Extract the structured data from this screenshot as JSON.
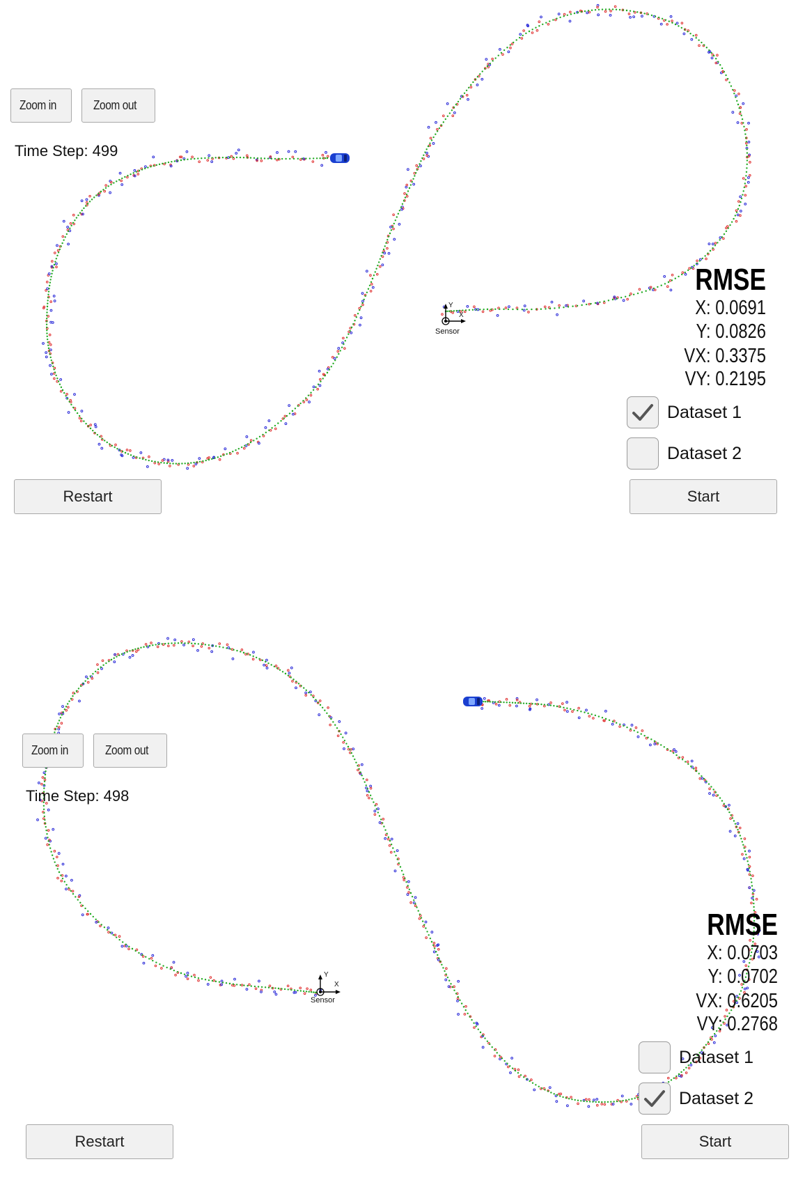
{
  "panels": [
    {
      "zoom_in_label": "Zoom in",
      "zoom_out_label": "Zoom out",
      "time_step": "Time Step: 499",
      "rmse_title": "RMSE",
      "rmse_x": "X: 0.0691",
      "rmse_y": "Y: 0.0826",
      "rmse_vx": "VX: 0.3375",
      "rmse_vy": "VY: 0.2195",
      "dataset1_label": "Dataset 1",
      "dataset1_checked": true,
      "dataset2_label": "Dataset 2",
      "dataset2_checked": false,
      "restart_label": "Restart",
      "start_label": "Start",
      "sensor_label": "Sensor",
      "axis_x": "X",
      "axis_y": "Y"
    },
    {
      "zoom_in_label": "Zoom in",
      "zoom_out_label": "Zoom out",
      "time_step": "Time Step: 498",
      "rmse_title": "RMSE",
      "rmse_x": "X: 0.0703",
      "rmse_y": "Y: 0.0702",
      "rmse_vx": "VX: 0.6205",
      "rmse_vy": "VY: 0.2768",
      "dataset1_label": "Dataset 1",
      "dataset1_checked": false,
      "dataset2_label": "Dataset 2",
      "dataset2_checked": true,
      "restart_label": "Restart",
      "start_label": "Start",
      "sensor_label": "Sensor",
      "axis_x": "X",
      "axis_y": "Y"
    }
  ],
  "colors": {
    "estimate": "#22aa22",
    "lidar": "#e03030",
    "radar": "#2a2ad8",
    "car": "#1a3fd0"
  }
}
